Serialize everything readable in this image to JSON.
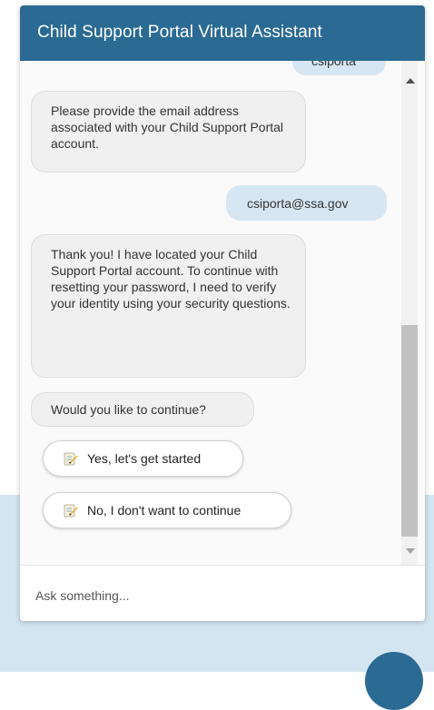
{
  "header": {
    "title": "Child Support Portal Virtual Assistant"
  },
  "messages": {
    "prev_user": "csiporta",
    "bot_1": "Please provide the email address associated with your Child Support Portal account.",
    "user_1": "csiporta@ssa.gov",
    "bot_2": "Thank you! I have located your Child Support Portal account. To continue with resetting your password, I need to verify your identity using your security questions.",
    "bot_3": "Would you like to continue?"
  },
  "options": {
    "yes_label": "Yes, let's get started",
    "no_label": "No, I don't want to continue",
    "icon": "checklist-icon"
  },
  "input": {
    "placeholder": "Ask something..."
  },
  "colors": {
    "header_bg": "#2a6a93",
    "user_bubble": "#d6e6f3",
    "bot_bubble": "#f0f0f0",
    "page_bottom_bg": "#d3e5f1"
  }
}
